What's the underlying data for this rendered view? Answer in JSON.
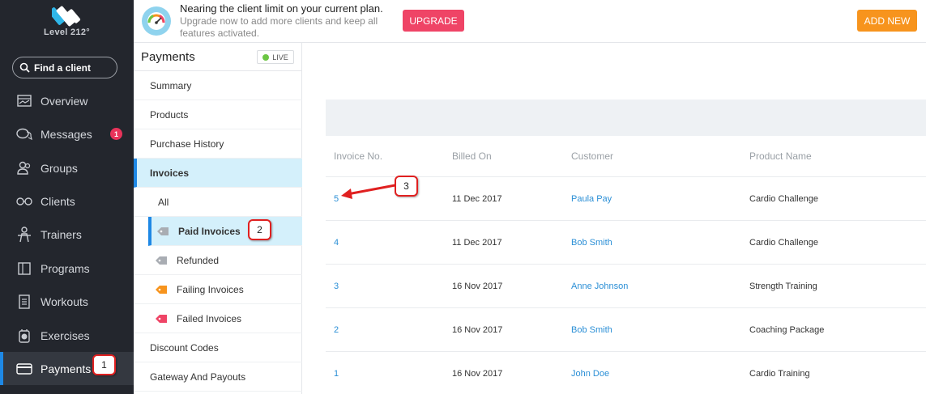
{
  "brand": {
    "name": "Level 212°"
  },
  "sidebar": {
    "search_label": "Find a client",
    "items": [
      {
        "label": "Overview",
        "icon": "overview-icon"
      },
      {
        "label": "Messages",
        "icon": "messages-icon",
        "badge": "1"
      },
      {
        "label": "Groups",
        "icon": "groups-icon"
      },
      {
        "label": "Clients",
        "icon": "clients-icon"
      },
      {
        "label": "Trainers",
        "icon": "trainers-icon"
      },
      {
        "label": "Programs",
        "icon": "programs-icon"
      },
      {
        "label": "Workouts",
        "icon": "workouts-icon"
      },
      {
        "label": "Exercises",
        "icon": "exercises-icon"
      },
      {
        "label": "Payments",
        "icon": "payments-icon",
        "active": true
      }
    ]
  },
  "banner": {
    "title": "Nearing the client limit on your current plan.",
    "subtitle": "Upgrade now to add more clients and keep all features activated.",
    "upgrade_label": "UPGRADE",
    "add_new_label": "ADD NEW"
  },
  "subnav": {
    "title": "Payments",
    "live_label": "LIVE",
    "items": {
      "summary": "Summary",
      "products": "Products",
      "purchase_history": "Purchase History",
      "invoices": "Invoices",
      "all": "All",
      "paid_invoices": "Paid Invoices",
      "refunded": "Refunded",
      "failing_invoices": "Failing Invoices",
      "failed_invoices": "Failed Invoices",
      "discount_codes": "Discount Codes",
      "gateway_payouts": "Gateway And Payouts"
    }
  },
  "colors": {
    "accent": "#1e88e5",
    "upgrade": "#ef4466",
    "add_new": "#f7941d",
    "link": "#2b8fd6",
    "live": "#6cc644"
  },
  "table": {
    "headers": {
      "invoice_no": "Invoice No.",
      "billed_on": "Billed On",
      "customer": "Customer",
      "product_name": "Product Name"
    },
    "rows": [
      {
        "invoice_no": "5",
        "billed_on": "11 Dec 2017",
        "customer": "Paula Pay",
        "product": "Cardio Challenge"
      },
      {
        "invoice_no": "4",
        "billed_on": "11 Dec 2017",
        "customer": "Bob Smith",
        "product": "Cardio Challenge"
      },
      {
        "invoice_no": "3",
        "billed_on": "16 Nov 2017",
        "customer": "Anne Johnson",
        "product": "Strength Training"
      },
      {
        "invoice_no": "2",
        "billed_on": "16 Nov 2017",
        "customer": "Bob Smith",
        "product": "Coaching Package"
      },
      {
        "invoice_no": "1",
        "billed_on": "16 Nov 2017",
        "customer": "John Doe",
        "product": "Cardio Training"
      }
    ]
  },
  "callouts": {
    "one": "1",
    "two": "2",
    "three": "3"
  }
}
